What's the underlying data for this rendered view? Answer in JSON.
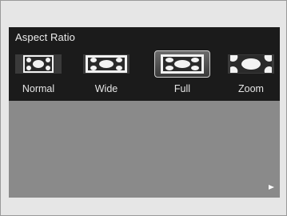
{
  "menu": {
    "title": "Aspect Ratio",
    "selected": "Full",
    "options": [
      {
        "label": "Normal",
        "icon": "aspect-normal-icon"
      },
      {
        "label": "Wide",
        "icon": "aspect-wide-icon"
      },
      {
        "label": "Full",
        "icon": "aspect-full-icon"
      },
      {
        "label": "Zoom",
        "icon": "aspect-zoom-icon"
      }
    ]
  },
  "colors": {
    "menu_background": "#1b1b1b",
    "screen_background": "#8a8a8a",
    "text": "#e6e6e6"
  }
}
